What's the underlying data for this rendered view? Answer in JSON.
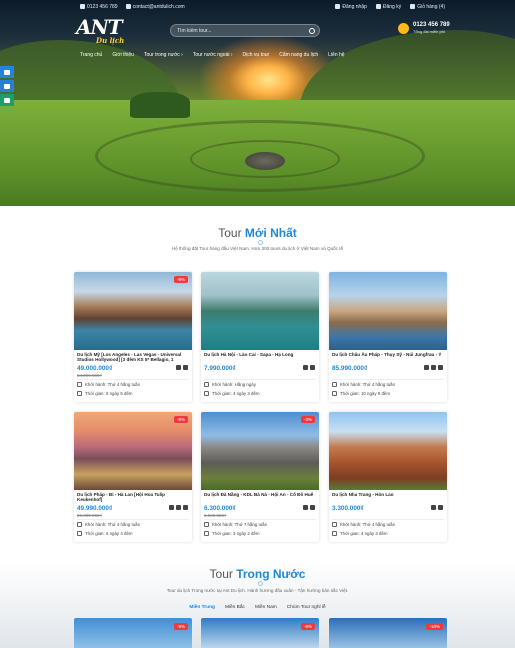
{
  "topbar": {
    "phone": "0123 456 789",
    "email": "contact@antdulich.com",
    "login": "Đăng nhập",
    "register": "Đăng ký",
    "cart": "Giỏ hàng (4)"
  },
  "logo": {
    "main": "ANT",
    "sub": "Du lịch"
  },
  "search": {
    "placeholder": "Tìm kiếm tour..."
  },
  "hotline": {
    "number": "0123 456 789",
    "sub": "Tổng đài miễn phí"
  },
  "nav": [
    "Trang chủ",
    "Giới thiệu",
    "Tour trong nước ›",
    "Tour nước ngoài ›",
    "Dịch vụ tour",
    "Cẩm nang du lịch",
    "Liên hệ"
  ],
  "section1": {
    "title_a": "Tour",
    "title_b": "Mới Nhất",
    "desc": "Hệ thống đặt Tour hàng đầu Việt Nam. Hơn 300 tours du lịch ở Việt Nam và Quốc tế"
  },
  "tours": [
    {
      "title": "Du lịch Mỹ [Los Angeles - Las Vegas - Universal Studios Hollywood] [3 đêm KS 5* Bellagio, 1",
      "price": "49.000.000₫",
      "old_price": "54.000.000₫",
      "badge": "-9%",
      "depart": "Khởi hành: Thứ 4 hằng tuần",
      "duration": "Thời gian: 6 ngày 5 đêm"
    },
    {
      "title": "Du lịch Hà Nội - Lào Cai - Sapa - Hạ Long",
      "price": "7.990.000₫",
      "old_price": "",
      "badge": "",
      "depart": "Khởi hành: Hằng ngày",
      "duration": "Thời gian: 4 ngày 3 đêm"
    },
    {
      "title": "Du lịch Châu Âu Pháp - Thụy Sỹ - Núi Jungfrau - Ý",
      "price": "85.990.000₫",
      "old_price": "",
      "badge": "",
      "depart": "Khởi hành: Thứ 4 hằng tuần",
      "duration": "Thời gian: 10 ngày 9 đêm"
    },
    {
      "title": "Du lịch Pháp - Bỉ - Hà Lan [Hội Hoa Tulip Keukenhof]",
      "price": "49.990.000₫",
      "old_price": "55.000.000₫",
      "badge": "-9%",
      "depart": "Khởi hành: Thứ 4 hằng tuần",
      "duration": "Thời gian: 5 ngày 4 đêm"
    },
    {
      "title": "Du lịch Đà Nẵng - KDL Bà Nà - Hội An - Cố Đô Huế",
      "price": "6.300.000₫",
      "old_price": "6.500.000₫",
      "badge": "-3%",
      "depart": "Khởi hành: Thứ 7 hằng tuần",
      "duration": "Thời gian: 3 ngày 2 đêm"
    },
    {
      "title": "Du lịch Nha Trang - Hòn Lao",
      "price": "3.300.000₫",
      "old_price": "",
      "badge": "",
      "depart": "Khởi hành: Thứ 4 hằng tuần",
      "duration": "Thời gian: 4 ngày 3 đêm"
    }
  ],
  "section2": {
    "title_a": "Tour",
    "title_b": "Trong Nước",
    "desc": "Tour du lịch Trong nước tại Ant Du lịch. Hành hương đầu xuân - Tận hưởng bản sắc Việt.",
    "tabs": [
      "Miền Trung",
      "Miền Bắc",
      "Miền Nam",
      "Chùm Tour nghỉ lễ"
    ],
    "badges": [
      "-9%",
      "-9%",
      "-10%"
    ]
  },
  "colors": {
    "accent": "#1e88d6",
    "badge": "#f0393f",
    "hotline": "#ffb81c"
  }
}
